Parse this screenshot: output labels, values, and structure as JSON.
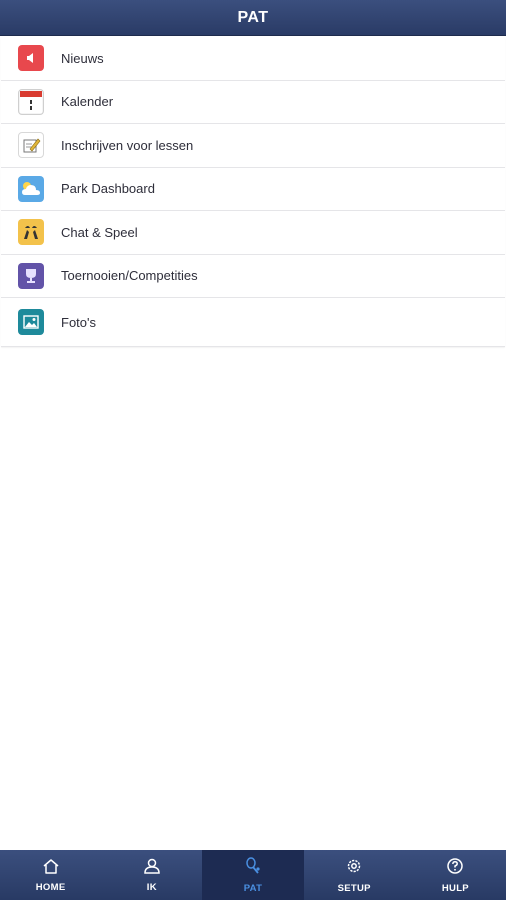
{
  "header": {
    "title": "PAT"
  },
  "menu": {
    "items": [
      {
        "label": "Nieuws",
        "icon": "megaphone-icon",
        "color": "#e8484d"
      },
      {
        "label": "Kalender",
        "icon": "calendar-icon",
        "color": "#d93b30"
      },
      {
        "label": "Inschrijven voor lessen",
        "icon": "clipboard-pencil-icon",
        "color": "#e0b63a"
      },
      {
        "label": "Park Dashboard",
        "icon": "weather-cloud-icon",
        "color": "#5aa9e6"
      },
      {
        "label": "Chat & Speel",
        "icon": "chess-knights-icon",
        "color": "#f3c24b"
      },
      {
        "label": "Toernooien/Competities",
        "icon": "trophy-icon",
        "color": "#6253a8"
      },
      {
        "label": "Foto's",
        "icon": "photo-icon",
        "color": "#1e8a9b"
      }
    ]
  },
  "tabbar": {
    "active": "PAT",
    "tabs": [
      {
        "label": "HOME",
        "icon": "home-icon"
      },
      {
        "label": "IK",
        "icon": "user-icon"
      },
      {
        "label": "PAT",
        "icon": "tennis-racket-icon"
      },
      {
        "label": "SETUP",
        "icon": "gear-icon"
      },
      {
        "label": "HULP",
        "icon": "help-icon"
      }
    ]
  }
}
